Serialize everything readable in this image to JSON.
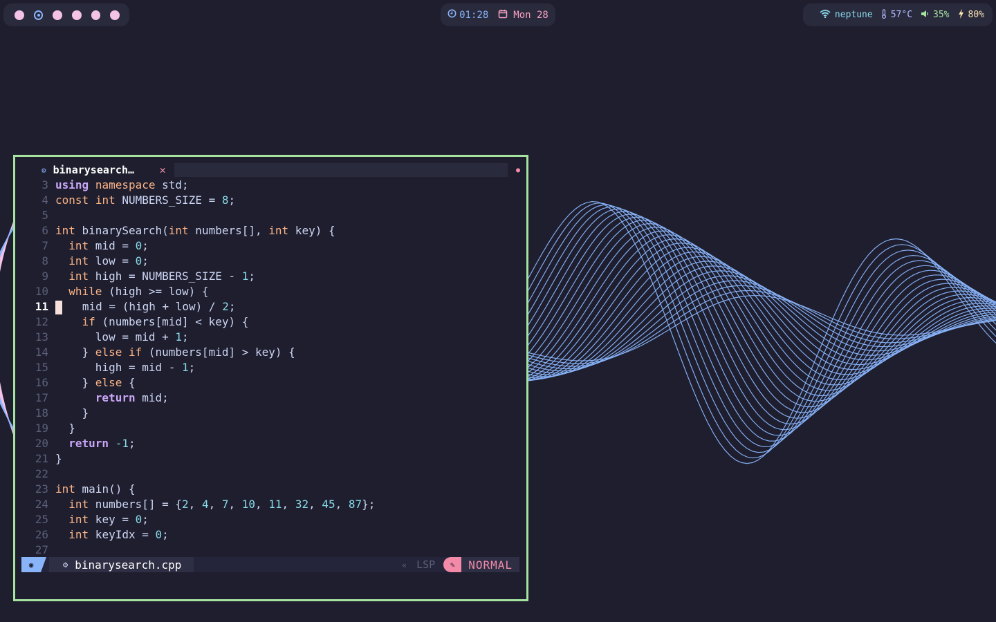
{
  "topbar": {
    "workspaces": [
      "ws-1",
      "ws-2",
      "ws-3",
      "ws-4",
      "ws-5",
      "ws-6"
    ],
    "active_workspace": 2,
    "clock_icon": "clock-icon",
    "time": "01:28",
    "calendar_icon": "calendar-icon",
    "date": "Mon 28",
    "wifi_icon": "wifi-icon",
    "hostname": "neptune",
    "temp_icon": "thermometer-icon",
    "temperature": "57°C",
    "volume_icon": "speaker-icon",
    "volume": "35%",
    "battery_icon": "bolt-icon",
    "battery": "80%"
  },
  "editor": {
    "tab": {
      "name": "binarysearch…",
      "close": "✕",
      "dirty_indicator": "●"
    },
    "current_line": 11,
    "lines": [
      {
        "n": "3",
        "t": [
          [
            "kw2",
            "using"
          ],
          [
            "txt",
            " "
          ],
          [
            "ns",
            "namespace"
          ],
          [
            "txt",
            " std;"
          ]
        ]
      },
      {
        "n": "4",
        "t": [
          [
            "kw",
            "const"
          ],
          [
            "txt",
            " "
          ],
          [
            "kw",
            "int"
          ],
          [
            "txt",
            " NUMBERS_SIZE = "
          ],
          [
            "num",
            "8"
          ],
          [
            "txt",
            ";"
          ]
        ]
      },
      {
        "n": "5",
        "t": []
      },
      {
        "n": "6",
        "t": [
          [
            "kw",
            "int"
          ],
          [
            "txt",
            " binarySearch("
          ],
          [
            "kw",
            "int"
          ],
          [
            "txt",
            " numbers[], "
          ],
          [
            "kw",
            "int"
          ],
          [
            "txt",
            " key) {"
          ]
        ]
      },
      {
        "n": "7",
        "t": [
          [
            "txt",
            "  "
          ],
          [
            "kw",
            "int"
          ],
          [
            "txt",
            " mid = "
          ],
          [
            "num",
            "0"
          ],
          [
            "txt",
            ";"
          ]
        ]
      },
      {
        "n": "8",
        "t": [
          [
            "txt",
            "  "
          ],
          [
            "kw",
            "int"
          ],
          [
            "txt",
            " low = "
          ],
          [
            "num",
            "0"
          ],
          [
            "txt",
            ";"
          ]
        ]
      },
      {
        "n": "9",
        "t": [
          [
            "txt",
            "  "
          ],
          [
            "kw",
            "int"
          ],
          [
            "txt",
            " high = NUMBERS_SIZE - "
          ],
          [
            "num",
            "1"
          ],
          [
            "txt",
            ";"
          ]
        ]
      },
      {
        "n": "10",
        "t": [
          [
            "txt",
            "  "
          ],
          [
            "kw",
            "while"
          ],
          [
            "txt",
            " (high >= low) {"
          ]
        ]
      },
      {
        "n": "11",
        "t": [
          [
            "cursor",
            ""
          ],
          [
            "txt",
            "   mid = (high + low) / "
          ],
          [
            "num",
            "2"
          ],
          [
            "txt",
            ";"
          ]
        ]
      },
      {
        "n": "12",
        "t": [
          [
            "txt",
            "    "
          ],
          [
            "kw",
            "if"
          ],
          [
            "txt",
            " (numbers[mid] < key) {"
          ]
        ]
      },
      {
        "n": "13",
        "t": [
          [
            "txt",
            "      low = mid + "
          ],
          [
            "num",
            "1"
          ],
          [
            "txt",
            ";"
          ]
        ]
      },
      {
        "n": "14",
        "t": [
          [
            "txt",
            "    } "
          ],
          [
            "kw",
            "else"
          ],
          [
            "txt",
            " "
          ],
          [
            "kw",
            "if"
          ],
          [
            "txt",
            " (numbers[mid] > key) {"
          ]
        ]
      },
      {
        "n": "15",
        "t": [
          [
            "txt",
            "      high = mid - "
          ],
          [
            "num",
            "1"
          ],
          [
            "txt",
            ";"
          ]
        ]
      },
      {
        "n": "16",
        "t": [
          [
            "txt",
            "    } "
          ],
          [
            "kw",
            "else"
          ],
          [
            "txt",
            " {"
          ]
        ]
      },
      {
        "n": "17",
        "t": [
          [
            "txt",
            "      "
          ],
          [
            "kw2",
            "return"
          ],
          [
            "txt",
            " mid;"
          ]
        ]
      },
      {
        "n": "18",
        "t": [
          [
            "txt",
            "    }"
          ]
        ]
      },
      {
        "n": "19",
        "t": [
          [
            "txt",
            "  }"
          ]
        ]
      },
      {
        "n": "20",
        "t": [
          [
            "txt",
            "  "
          ],
          [
            "kw2",
            "return"
          ],
          [
            "txt",
            " "
          ],
          [
            "num",
            "-1"
          ],
          [
            "txt",
            ";"
          ]
        ]
      },
      {
        "n": "21",
        "t": [
          [
            "txt",
            "}"
          ]
        ]
      },
      {
        "n": "22",
        "t": []
      },
      {
        "n": "23",
        "t": [
          [
            "kw",
            "int"
          ],
          [
            "txt",
            " main() {"
          ]
        ]
      },
      {
        "n": "24",
        "t": [
          [
            "txt",
            "  "
          ],
          [
            "kw",
            "int"
          ],
          [
            "txt",
            " numbers[] = {"
          ],
          [
            "num",
            "2"
          ],
          [
            "txt",
            ", "
          ],
          [
            "num",
            "4"
          ],
          [
            "txt",
            ", "
          ],
          [
            "num",
            "7"
          ],
          [
            "txt",
            ", "
          ],
          [
            "num",
            "10"
          ],
          [
            "txt",
            ", "
          ],
          [
            "num",
            "11"
          ],
          [
            "txt",
            ", "
          ],
          [
            "num",
            "32"
          ],
          [
            "txt",
            ", "
          ],
          [
            "num",
            "45"
          ],
          [
            "txt",
            ", "
          ],
          [
            "num",
            "87"
          ],
          [
            "txt",
            "};"
          ]
        ]
      },
      {
        "n": "25",
        "t": [
          [
            "txt",
            "  "
          ],
          [
            "kw",
            "int"
          ],
          [
            "txt",
            " key = "
          ],
          [
            "num",
            "0"
          ],
          [
            "txt",
            ";"
          ]
        ]
      },
      {
        "n": "26",
        "t": [
          [
            "txt",
            "  "
          ],
          [
            "kw",
            "int"
          ],
          [
            "txt",
            " keyIdx = "
          ],
          [
            "num",
            "0"
          ],
          [
            "txt",
            ";"
          ]
        ]
      },
      {
        "n": "27",
        "t": []
      }
    ],
    "statusline": {
      "filename": "binarysearch.cpp",
      "lsp": "LSP",
      "mode": "NORMAL"
    }
  },
  "colors": {
    "background": "#1e1e2e",
    "border": "#a6e3a1",
    "keyword": "#fab387",
    "number": "#89dceb",
    "wave_blue": "#89b4fa",
    "wave_pink": "#f5c2e7"
  }
}
